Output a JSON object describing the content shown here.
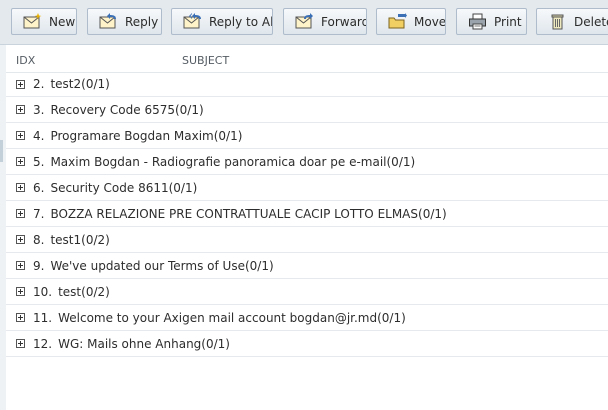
{
  "toolbar": {
    "buttons": [
      {
        "label": "New",
        "icon": "envelope-new-icon"
      },
      {
        "label": "Reply",
        "icon": "envelope-reply-icon"
      },
      {
        "label": "Reply to All",
        "icon": "envelope-reply-all-icon"
      },
      {
        "label": "Forward",
        "icon": "envelope-forward-icon"
      },
      {
        "label": "Move",
        "icon": "move-folder-icon"
      },
      {
        "label": "Print",
        "icon": "printer-icon"
      },
      {
        "label": "Delete",
        "icon": "trash-icon"
      }
    ]
  },
  "list": {
    "columns": {
      "idx": "IDX",
      "subject": "SUBJECT"
    },
    "rows": [
      {
        "idx": "2.",
        "subject": "test2(0/1)"
      },
      {
        "idx": "3.",
        "subject": "Recovery Code 6575(0/1)"
      },
      {
        "idx": "4.",
        "subject": "Programare Bogdan Maxim(0/1)"
      },
      {
        "idx": "5.",
        "subject": "Maxim Bogdan - Radiografie panoramica doar pe e-mail(0/1)"
      },
      {
        "idx": "6.",
        "subject": "Security Code 8611(0/1)"
      },
      {
        "idx": "7.",
        "subject": "BOZZA RELAZIONE PRE CONTRATTUALE CACIP LOTTO ELMAS(0/1)"
      },
      {
        "idx": "8.",
        "subject": "test1(0/2)"
      },
      {
        "idx": "9.",
        "subject": "We've updated our Terms of Use(0/1)"
      },
      {
        "idx": "10.",
        "subject": "test(0/2)"
      },
      {
        "idx": "11.",
        "subject": "Welcome to your Axigen mail account bogdan@jr.md(0/1)"
      },
      {
        "idx": "12.",
        "subject": "WG: Mails ohne Anhang(0/1)"
      }
    ]
  }
}
